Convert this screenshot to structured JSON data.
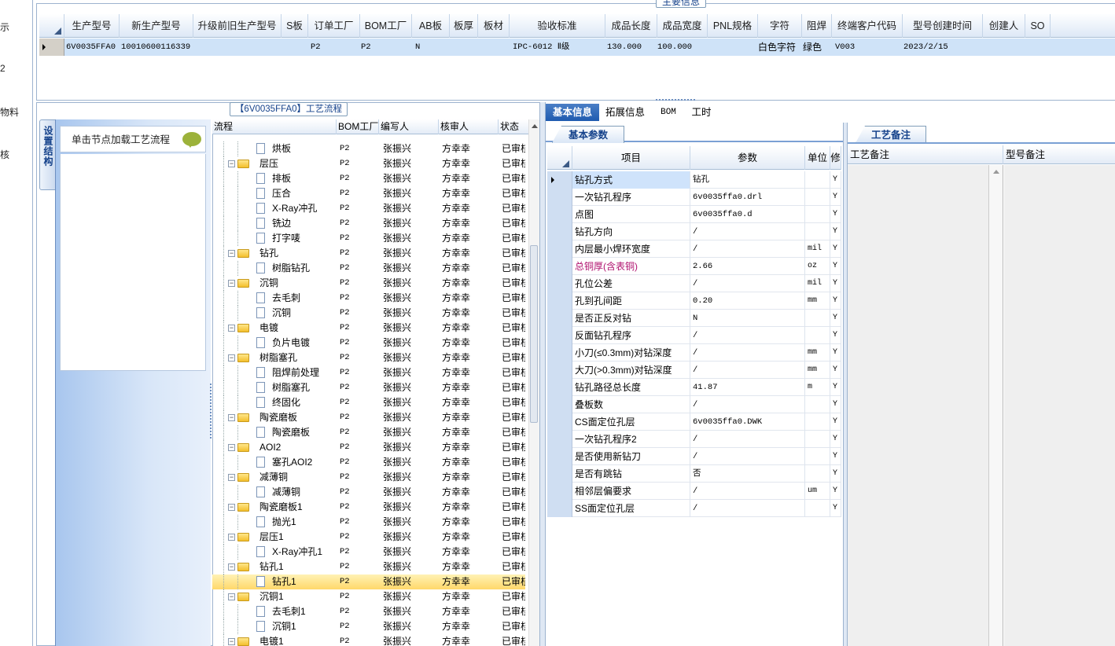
{
  "left_nav": [
    "示",
    "2",
    "物料",
    "核"
  ],
  "top": {
    "title": "主要信息",
    "columns": [
      "生产型号",
      "新生产型号",
      "升级前旧生产型号",
      "S板",
      "订单工厂",
      "BOM工厂",
      "AB板",
      "板厚",
      "板材",
      "验收标准",
      "成品长度",
      "成品宽度",
      "PNL规格",
      "字符",
      "阻焊",
      "终端客户代码",
      "型号创建时间",
      "创建人",
      "SO"
    ],
    "row": {
      "model": "6V0035FFA0",
      "new_model": "10010600116339",
      "order_factory": "P2",
      "bom_factory": "P2",
      "ab": "N",
      "standard": "IPC-6012 Ⅱ级",
      "length": "130.000",
      "width": "100.000",
      "char": "白色字符",
      "mask": "绿色",
      "customer": "V003",
      "created": "2023/2/15"
    }
  },
  "process": {
    "title": "【6V0035FFA0】工艺流程",
    "nav_tab": "设置结构",
    "nav_button": "单击节点加载工艺流程",
    "columns": [
      "流程",
      "BOM工厂",
      "编写人",
      "核审人",
      "状态"
    ],
    "rows": [
      {
        "name": "烘板",
        "level": 1,
        "folder": false,
        "bom": "P2",
        "writer": "张振兴",
        "reviewer": "方幸幸",
        "status": "已审核"
      },
      {
        "name": "层压",
        "level": 0,
        "folder": true,
        "bom": "P2",
        "writer": "张振兴",
        "reviewer": "方幸幸",
        "status": "已审核"
      },
      {
        "name": "排板",
        "level": 1,
        "folder": false,
        "bom": "P2",
        "writer": "张振兴",
        "reviewer": "方幸幸",
        "status": "已审核"
      },
      {
        "name": "压合",
        "level": 1,
        "folder": false,
        "bom": "P2",
        "writer": "张振兴",
        "reviewer": "方幸幸",
        "status": "已审核"
      },
      {
        "name": "X-Ray冲孔",
        "level": 1,
        "folder": false,
        "bom": "P2",
        "writer": "张振兴",
        "reviewer": "方幸幸",
        "status": "已审核"
      },
      {
        "name": "铣边",
        "level": 1,
        "folder": false,
        "bom": "P2",
        "writer": "张振兴",
        "reviewer": "方幸幸",
        "status": "已审核"
      },
      {
        "name": "打字唛",
        "level": 1,
        "folder": false,
        "bom": "P2",
        "writer": "张振兴",
        "reviewer": "方幸幸",
        "status": "已审核"
      },
      {
        "name": "钻孔",
        "level": 0,
        "folder": true,
        "bom": "P2",
        "writer": "张振兴",
        "reviewer": "方幸幸",
        "status": "已审核"
      },
      {
        "name": "树脂钻孔",
        "level": 1,
        "folder": false,
        "bom": "P2",
        "writer": "张振兴",
        "reviewer": "方幸幸",
        "status": "已审核"
      },
      {
        "name": "沉铜",
        "level": 0,
        "folder": true,
        "bom": "P2",
        "writer": "张振兴",
        "reviewer": "方幸幸",
        "status": "已审核"
      },
      {
        "name": "去毛刺",
        "level": 1,
        "folder": false,
        "bom": "P2",
        "writer": "张振兴",
        "reviewer": "方幸幸",
        "status": "已审核"
      },
      {
        "name": "沉铜",
        "level": 1,
        "folder": false,
        "bom": "P2",
        "writer": "张振兴",
        "reviewer": "方幸幸",
        "status": "已审核"
      },
      {
        "name": "电镀",
        "level": 0,
        "folder": true,
        "bom": "P2",
        "writer": "张振兴",
        "reviewer": "方幸幸",
        "status": "已审核"
      },
      {
        "name": "负片电镀",
        "level": 1,
        "folder": false,
        "bom": "P2",
        "writer": "张振兴",
        "reviewer": "方幸幸",
        "status": "已审核"
      },
      {
        "name": "树脂塞孔",
        "level": 0,
        "folder": true,
        "bom": "P2",
        "writer": "张振兴",
        "reviewer": "方幸幸",
        "status": "已审核"
      },
      {
        "name": "阻焊前处理",
        "level": 1,
        "folder": false,
        "bom": "P2",
        "writer": "张振兴",
        "reviewer": "方幸幸",
        "status": "已审核"
      },
      {
        "name": "树脂塞孔",
        "level": 1,
        "folder": false,
        "bom": "P2",
        "writer": "张振兴",
        "reviewer": "方幸幸",
        "status": "已审核"
      },
      {
        "name": "终固化",
        "level": 1,
        "folder": false,
        "bom": "P2",
        "writer": "张振兴",
        "reviewer": "方幸幸",
        "status": "已审核"
      },
      {
        "name": "陶瓷磨板",
        "level": 0,
        "folder": true,
        "bom": "P2",
        "writer": "张振兴",
        "reviewer": "方幸幸",
        "status": "已审核"
      },
      {
        "name": "陶瓷磨板",
        "level": 1,
        "folder": false,
        "bom": "P2",
        "writer": "张振兴",
        "reviewer": "方幸幸",
        "status": "已审核"
      },
      {
        "name": "AOI2",
        "level": 0,
        "folder": true,
        "bom": "P2",
        "writer": "张振兴",
        "reviewer": "方幸幸",
        "status": "已审核"
      },
      {
        "name": "塞孔AOI2",
        "level": 1,
        "folder": false,
        "bom": "P2",
        "writer": "张振兴",
        "reviewer": "方幸幸",
        "status": "已审核"
      },
      {
        "name": "减薄铜",
        "level": 0,
        "folder": true,
        "bom": "P2",
        "writer": "张振兴",
        "reviewer": "方幸幸",
        "status": "已审核"
      },
      {
        "name": "减薄铜",
        "level": 1,
        "folder": false,
        "bom": "P2",
        "writer": "张振兴",
        "reviewer": "方幸幸",
        "status": "已审核"
      },
      {
        "name": "陶瓷磨板1",
        "level": 0,
        "folder": true,
        "bom": "P2",
        "writer": "张振兴",
        "reviewer": "方幸幸",
        "status": "已审核"
      },
      {
        "name": "抛光1",
        "level": 1,
        "folder": false,
        "bom": "P2",
        "writer": "张振兴",
        "reviewer": "方幸幸",
        "status": "已审核"
      },
      {
        "name": "层压1",
        "level": 0,
        "folder": true,
        "bom": "P2",
        "writer": "张振兴",
        "reviewer": "方幸幸",
        "status": "已审核"
      },
      {
        "name": "X-Ray冲孔1",
        "level": 1,
        "folder": false,
        "bom": "P2",
        "writer": "张振兴",
        "reviewer": "方幸幸",
        "status": "已审核"
      },
      {
        "name": "钻孔1",
        "level": 0,
        "folder": true,
        "bom": "P2",
        "writer": "张振兴",
        "reviewer": "方幸幸",
        "status": "已审核"
      },
      {
        "name": "钻孔1",
        "level": 1,
        "folder": false,
        "bom": "P2",
        "writer": "张振兴",
        "reviewer": "方幸幸",
        "status": "已审核",
        "selected": true
      },
      {
        "name": "沉铜1",
        "level": 0,
        "folder": true,
        "bom": "P2",
        "writer": "张振兴",
        "reviewer": "方幸幸",
        "status": "已审核"
      },
      {
        "name": "去毛刺1",
        "level": 1,
        "folder": false,
        "bom": "P2",
        "writer": "张振兴",
        "reviewer": "方幸幸",
        "status": "已审核"
      },
      {
        "name": "沉铜1",
        "level": 1,
        "folder": false,
        "bom": "P2",
        "writer": "张振兴",
        "reviewer": "方幸幸",
        "status": "已审核"
      },
      {
        "name": "电镀1",
        "level": 0,
        "folder": true,
        "bom": "P2",
        "writer": "张振兴",
        "reviewer": "方幸幸",
        "status": "已审核"
      }
    ]
  },
  "tabs": [
    "基本信息",
    "拓展信息",
    "BOM",
    "工时"
  ],
  "basic": {
    "subtab": "基本参数",
    "columns": [
      "项目",
      "参数",
      "单位",
      "修"
    ],
    "rows": [
      {
        "item": "钻孔方式",
        "value": "钻孔",
        "unit": "",
        "mod": "Y"
      },
      {
        "item": "一次钻孔程序",
        "value": "6v0035ffa0.drl",
        "unit": "",
        "mod": "Y"
      },
      {
        "item": "点图",
        "value": "6v0035ffa0.d",
        "unit": "",
        "mod": "Y"
      },
      {
        "item": "钻孔方向",
        "value": "/",
        "unit": "",
        "mod": "Y"
      },
      {
        "item": "内层最小焊环宽度",
        "value": "/",
        "unit": "mil",
        "mod": "Y"
      },
      {
        "item": "总铜厚(含表铜)",
        "value": "2.66",
        "unit": "oz",
        "mod": "Y",
        "highlight": true
      },
      {
        "item": "孔位公差",
        "value": "/",
        "unit": "mil",
        "mod": "Y"
      },
      {
        "item": "孔到孔间距",
        "value": "0.20",
        "unit": "mm",
        "mod": "Y"
      },
      {
        "item": "是否正反对钻",
        "value": "N",
        "unit": "",
        "mod": "Y"
      },
      {
        "item": "反面钻孔程序",
        "value": "/",
        "unit": "",
        "mod": "Y"
      },
      {
        "item": "小刀(≤0.3mm)对钻深度",
        "value": "/",
        "unit": "mm",
        "mod": "Y"
      },
      {
        "item": "大刀(>0.3mm)对钻深度",
        "value": "/",
        "unit": "mm",
        "mod": "Y"
      },
      {
        "item": "钻孔路径总长度",
        "value": "41.87",
        "unit": "m",
        "mod": "Y"
      },
      {
        "item": "叠板数",
        "value": "/",
        "unit": "",
        "mod": "Y"
      },
      {
        "item": "CS面定位孔层",
        "value": "6v0035ffa0.DWK",
        "unit": "",
        "mod": "Y"
      },
      {
        "item": "一次钻孔程序2",
        "value": "/",
        "unit": "",
        "mod": "Y"
      },
      {
        "item": "是否使用新钻刀",
        "value": "/",
        "unit": "",
        "mod": "Y"
      },
      {
        "item": "是否有跳钻",
        "value": "否",
        "unit": "",
        "mod": "Y"
      },
      {
        "item": "相邻层偏要求",
        "value": "/",
        "unit": "um",
        "mod": "Y"
      },
      {
        "item": "SS面定位孔层",
        "value": "/",
        "unit": "",
        "mod": "Y"
      }
    ]
  },
  "remarks": {
    "tab": "工艺备注",
    "col1": "工艺备注",
    "col2": "型号备注"
  }
}
